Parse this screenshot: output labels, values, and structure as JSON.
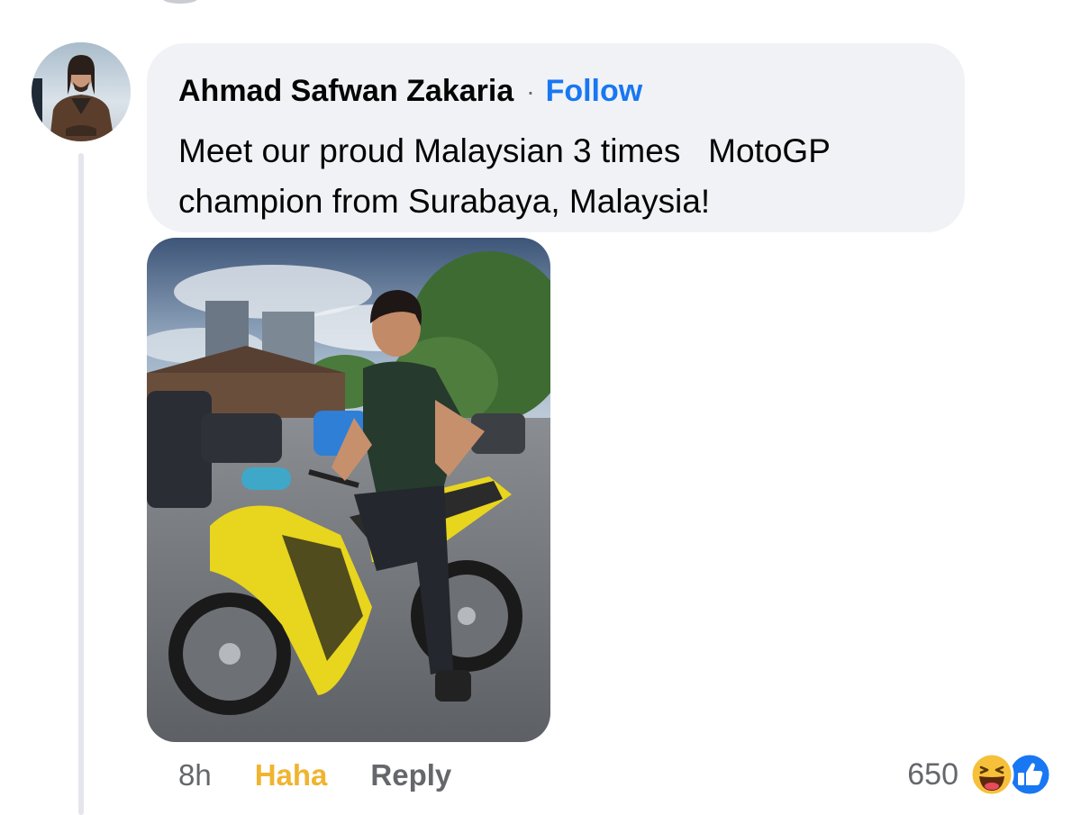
{
  "comment": {
    "author": "Ahmad Safwan Zakaria",
    "separator": "·",
    "follow_label": "Follow",
    "text": "Meet our proud Malaysian 3 times   MotoGP champion from Surabaya, Malaysia!",
    "photo_description": "man seated on a yellow and black motorcycle"
  },
  "actions": {
    "time": "8h",
    "reaction_label": "Haha",
    "reply_label": "Reply"
  },
  "reactions": {
    "count": "650",
    "icons": [
      "haha-icon",
      "like-icon"
    ]
  },
  "colors": {
    "bubble": "#f0f2f5",
    "link": "#1877f2",
    "haha": "#f0b430",
    "secondary_text": "#65676b"
  }
}
